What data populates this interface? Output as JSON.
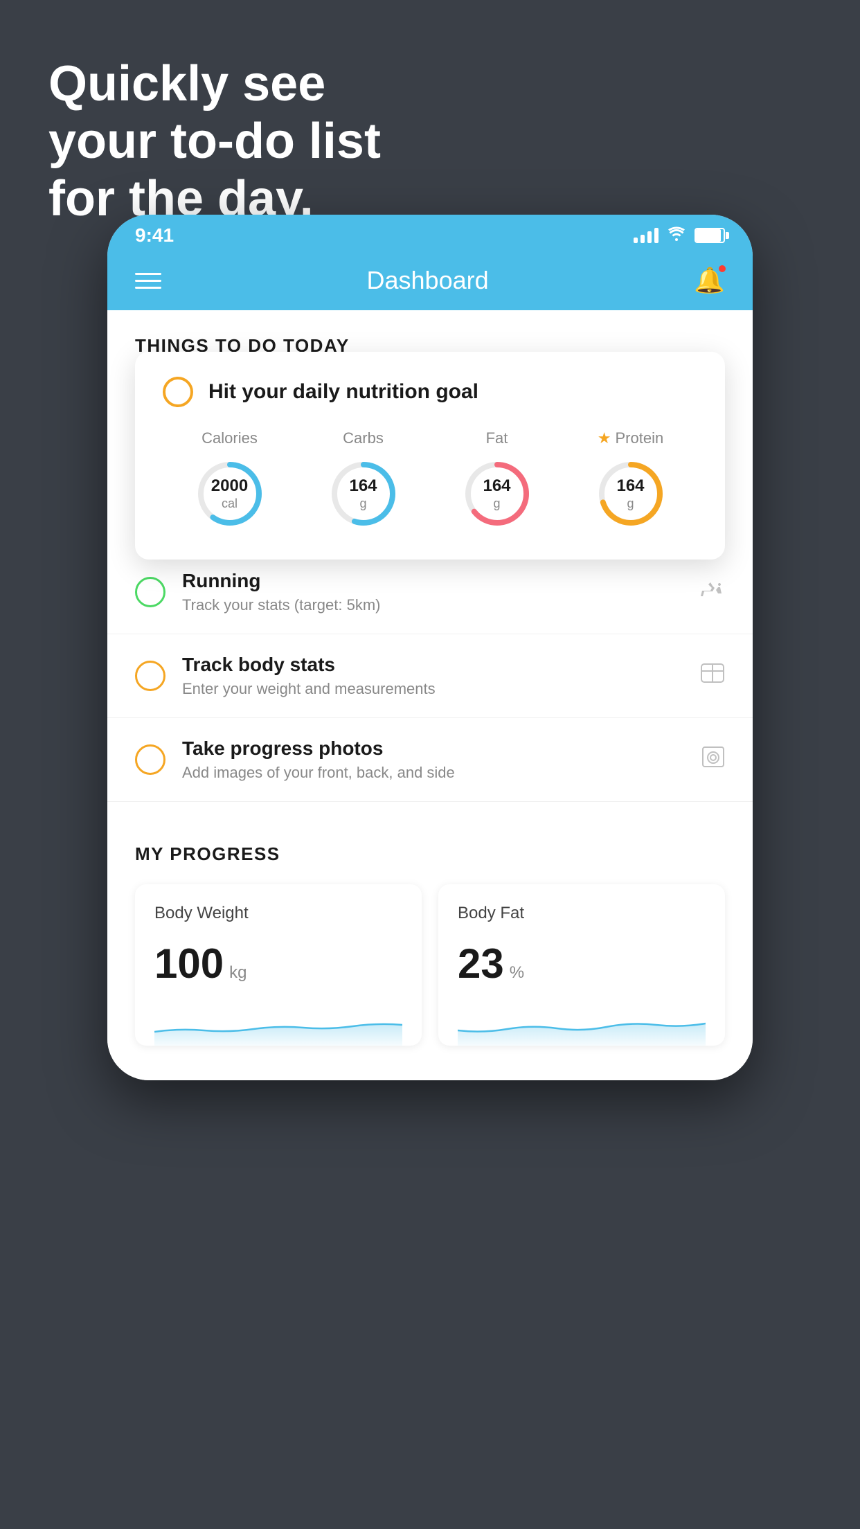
{
  "headline": {
    "line1": "Quickly see",
    "line2": "your to-do list",
    "line3": "for the day."
  },
  "phone": {
    "statusBar": {
      "time": "9:41"
    },
    "navBar": {
      "title": "Dashboard"
    },
    "thingsSection": {
      "header": "THINGS TO DO TODAY"
    },
    "floatingCard": {
      "title": "Hit your daily nutrition goal",
      "items": [
        {
          "label": "Calories",
          "value": "2000",
          "unit": "cal",
          "color": "#4bbde8",
          "pct": 60
        },
        {
          "label": "Carbs",
          "value": "164",
          "unit": "g",
          "color": "#4bbde8",
          "pct": 55
        },
        {
          "label": "Fat",
          "value": "164",
          "unit": "g",
          "color": "#f46b7c",
          "pct": 65
        },
        {
          "label": "Protein",
          "value": "164",
          "unit": "g",
          "color": "#f5a623",
          "pct": 70,
          "starred": true
        }
      ]
    },
    "todoItems": [
      {
        "title": "Running",
        "subtitle": "Track your stats (target: 5km)",
        "circleColor": "green",
        "icon": "👟"
      },
      {
        "title": "Track body stats",
        "subtitle": "Enter your weight and measurements",
        "circleColor": "yellow",
        "icon": "⚖"
      },
      {
        "title": "Take progress photos",
        "subtitle": "Add images of your front, back, and side",
        "circleColor": "yellow",
        "icon": "🖼"
      }
    ],
    "progressSection": {
      "header": "MY PROGRESS",
      "cards": [
        {
          "title": "Body Weight",
          "value": "100",
          "unit": "kg"
        },
        {
          "title": "Body Fat",
          "value": "23",
          "unit": "%"
        }
      ]
    }
  }
}
